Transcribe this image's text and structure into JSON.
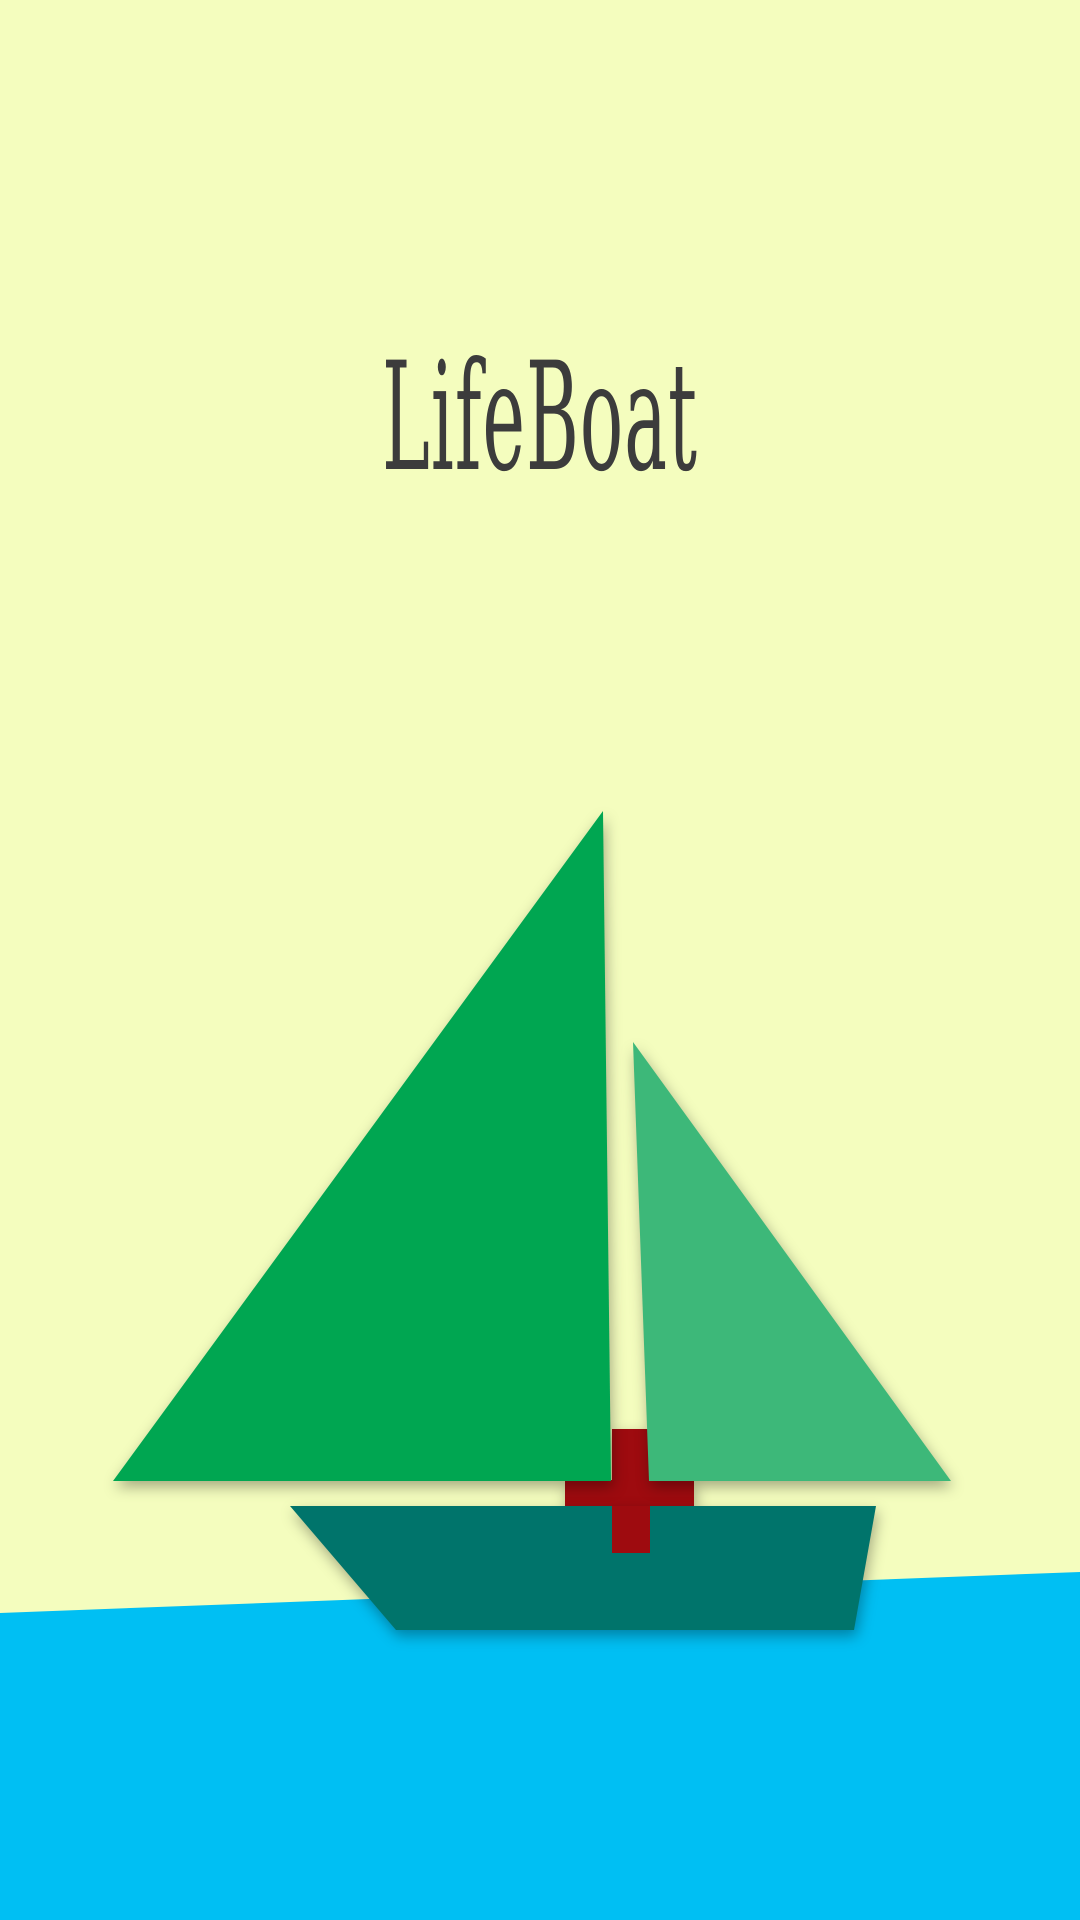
{
  "app": {
    "title": "LifeBoat"
  },
  "colors": {
    "background": "#F4FDBE",
    "water": "#00BFF3",
    "main_sail": "#00A651",
    "jib_sail": "#3DB879",
    "hull": "#00746B",
    "cross": "#9E0B0F",
    "title_text": "#3C3C3C"
  },
  "icons": {
    "logo": "sailboat-with-red-cross-icon"
  }
}
